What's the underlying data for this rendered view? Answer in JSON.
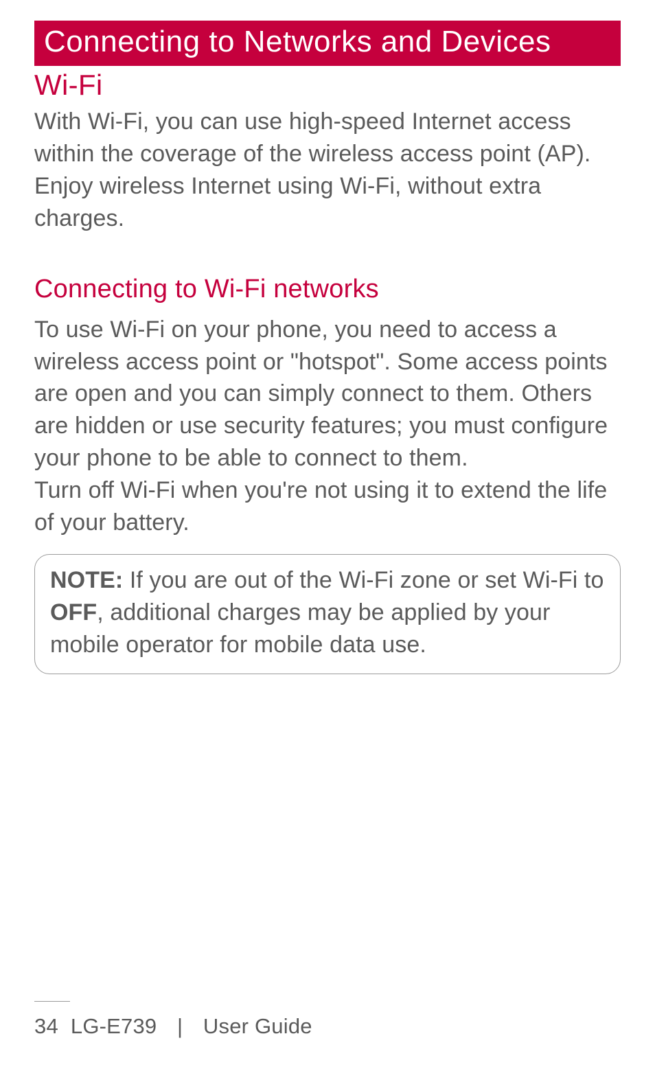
{
  "chapter_title": "Connecting to Networks and Devices",
  "section": {
    "heading": "Wi-Fi",
    "para": "With Wi-Fi, you can use high-speed Internet access within the coverage of the wireless access point (AP). Enjoy wireless Internet using Wi-Fi, without extra charges."
  },
  "subsection": {
    "heading": "Connecting to Wi-Fi networks",
    "para1": "To use Wi-Fi on your phone, you need to access a wireless access point or \"hotspot\". Some access points are open and you can simply connect to them. Others are hidden or use security features; you must configure your phone to be able to connect to them.",
    "para2": "Turn off Wi-Fi when you're not using it to extend the life of your battery."
  },
  "note": {
    "label": "NOTE:",
    "text_before_off": " If you are out of the Wi-Fi zone or set Wi-Fi to ",
    "off": "OFF",
    "text_after_off": ", additional charges may be applied by your mobile operator for mobile data use."
  },
  "footer": {
    "page_number": "34",
    "model": "LG-E739",
    "separator": "|",
    "doc_title": "User Guide"
  }
}
